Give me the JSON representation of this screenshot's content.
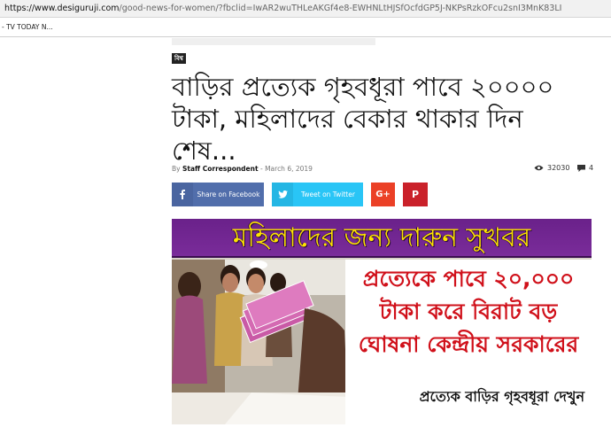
{
  "browser": {
    "url_domain": "https://www.desiguruji.com",
    "url_path": "/good-news-for-women/?fbclid=IwAR2wuTHLeAKGf4e8-EWHNLtHJSfOcfdGP5J-NKPsRzkOFcu2snI3MnK83LI",
    "bookmark": "- TV TODAY N..."
  },
  "article": {
    "category": "বিশ্ব",
    "title": "বাড়ির প্রত্যেক গৃহবধূরা পাবে ২০০০০ টাকা, মহিলাদের বেকার থাকার দিন শেষ...",
    "by": "By",
    "author": "Staff Correspondent",
    "separator": "-",
    "date": "March 6, 2019",
    "views": "32030",
    "comments": "4"
  },
  "share": {
    "facebook": "Share on Facebook",
    "twitter": "Tweet on Twitter",
    "google": "G+",
    "pinterest": "P"
  },
  "banner": {
    "top_text": "মহিলাদের জন্য দারুন সুখবর",
    "line1": "প্রত্যেকে পাবে ২০,০০০",
    "line2": "টাকা করে বিরাট বড়",
    "line3": "ঘোষনা কেন্দ্রীয় সরকারের",
    "bottom_text": "প্রত্যেক বাড়ির গৃহবধূরা দেখুন"
  }
}
